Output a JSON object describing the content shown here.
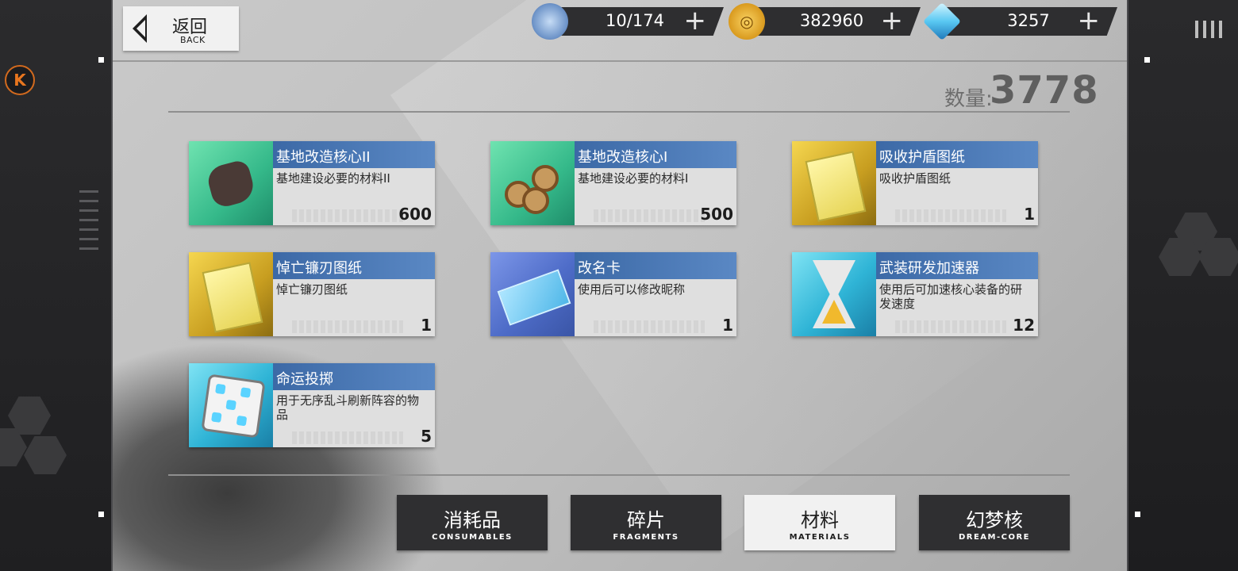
{
  "back_button": {
    "label_cn": "返回",
    "label_en": "BACK"
  },
  "resources": {
    "stamina": {
      "icon": "stamina-icon",
      "value": "10/174",
      "plus": "+"
    },
    "coins": {
      "icon": "coin-icon",
      "value": "382960",
      "plus": "+"
    },
    "crystals": {
      "icon": "crystal-icon",
      "value": "3257",
      "plus": "+"
    }
  },
  "inventory": {
    "count_label": "数量:",
    "count_value": "3778"
  },
  "items": [
    {
      "name": "基地改造核心II",
      "desc": "基地建设必要的材料II",
      "qty": "600",
      "icon": "ore-icon",
      "color": "green"
    },
    {
      "name": "基地改造核心I",
      "desc": "基地建设必要的材料I",
      "qty": "500",
      "icon": "logs-icon",
      "color": "green"
    },
    {
      "name": "吸收护盾图纸",
      "desc": "吸收护盾图纸",
      "qty": "1",
      "icon": "blueprint-icon",
      "color": "gold"
    },
    {
      "name": "悼亡镰刃图纸",
      "desc": "悼亡镰刃图纸",
      "qty": "1",
      "icon": "blueprint-icon",
      "color": "gold"
    },
    {
      "name": "改名卡",
      "desc": "使用后可以修改昵称",
      "qty": "1",
      "icon": "ticket-icon",
      "color": "blue"
    },
    {
      "name": "武装研发加速器",
      "desc": "使用后可加速核心装备的研发速度",
      "qty": "12",
      "icon": "hourglass-icon",
      "color": "cyan"
    },
    {
      "name": "命运投掷",
      "desc": "用于无序乱斗刷新阵容的物品",
      "qty": "5",
      "icon": "dice-icon",
      "color": "cyan"
    }
  ],
  "tabs": [
    {
      "cn": "消耗品",
      "en": "CONSUMABLES",
      "active": false
    },
    {
      "cn": "碎片",
      "en": "FRAGMENTS",
      "active": false
    },
    {
      "cn": "材料",
      "en": "MATERIALS",
      "active": true
    },
    {
      "cn": "幻梦核",
      "en": "DREAM-CORE",
      "active": false
    }
  ],
  "side": {
    "badge": "K"
  }
}
